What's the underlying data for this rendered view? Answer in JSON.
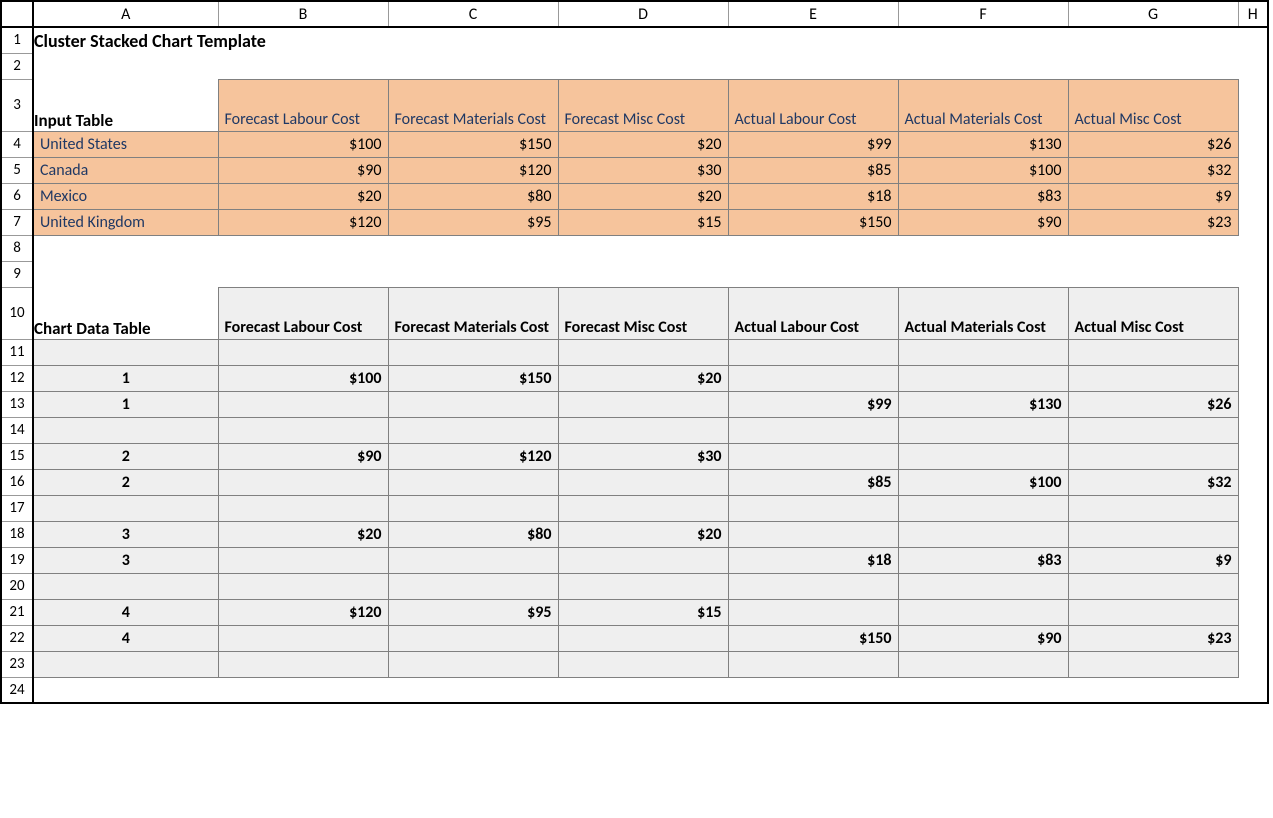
{
  "columns": [
    "A",
    "B",
    "C",
    "D",
    "E",
    "F",
    "G",
    "H"
  ],
  "title": "Cluster Stacked Chart Template",
  "input_table": {
    "label": "Input Table",
    "headers": [
      "Forecast Labour Cost",
      "Forecast Materials Cost",
      "Forecast Misc Cost",
      "Actual Labour Cost",
      "Actual Materials Cost",
      "Actual Misc Cost"
    ],
    "rows": [
      {
        "label": "United States",
        "values": [
          "$100",
          "$150",
          "$20",
          "$99",
          "$130",
          "$26"
        ]
      },
      {
        "label": "Canada",
        "values": [
          "$90",
          "$120",
          "$30",
          "$85",
          "$100",
          "$32"
        ]
      },
      {
        "label": "Mexico",
        "values": [
          "$20",
          "$80",
          "$20",
          "$18",
          "$83",
          "$9"
        ]
      },
      {
        "label": "United Kingdom",
        "values": [
          "$120",
          "$95",
          "$15",
          "$150",
          "$90",
          "$23"
        ]
      }
    ]
  },
  "chart_table": {
    "label": "Chart Data Table",
    "headers": [
      "Forecast Labour Cost",
      "Forecast Materials Cost",
      "Forecast Misc Cost",
      "Actual Labour Cost",
      "Actual Materials Cost",
      "Actual Misc Cost"
    ],
    "rows": [
      {
        "a": "",
        "v": [
          "",
          "",
          "",
          "",
          "",
          ""
        ]
      },
      {
        "a": "1",
        "v": [
          "$100",
          "$150",
          "$20",
          "",
          "",
          ""
        ]
      },
      {
        "a": "1",
        "v": [
          "",
          "",
          "",
          "$99",
          "$130",
          "$26"
        ]
      },
      {
        "a": "",
        "v": [
          "",
          "",
          "",
          "",
          "",
          ""
        ]
      },
      {
        "a": "2",
        "v": [
          "$90",
          "$120",
          "$30",
          "",
          "",
          ""
        ]
      },
      {
        "a": "2",
        "v": [
          "",
          "",
          "",
          "$85",
          "$100",
          "$32"
        ]
      },
      {
        "a": "",
        "v": [
          "",
          "",
          "",
          "",
          "",
          ""
        ]
      },
      {
        "a": "3",
        "v": [
          "$20",
          "$80",
          "$20",
          "",
          "",
          ""
        ]
      },
      {
        "a": "3",
        "v": [
          "",
          "",
          "",
          "$18",
          "$83",
          "$9"
        ]
      },
      {
        "a": "",
        "v": [
          "",
          "",
          "",
          "",
          "",
          ""
        ]
      },
      {
        "a": "4",
        "v": [
          "$120",
          "$95",
          "$15",
          "",
          "",
          ""
        ]
      },
      {
        "a": "4",
        "v": [
          "",
          "",
          "",
          "$150",
          "$90",
          "$23"
        ]
      },
      {
        "a": "",
        "v": [
          "",
          "",
          "",
          "",
          "",
          ""
        ]
      }
    ]
  },
  "row_numbers": [
    1,
    2,
    3,
    4,
    5,
    6,
    7,
    8,
    9,
    10,
    11,
    12,
    13,
    14,
    15,
    16,
    17,
    18,
    19,
    20,
    21,
    22,
    23,
    24
  ]
}
